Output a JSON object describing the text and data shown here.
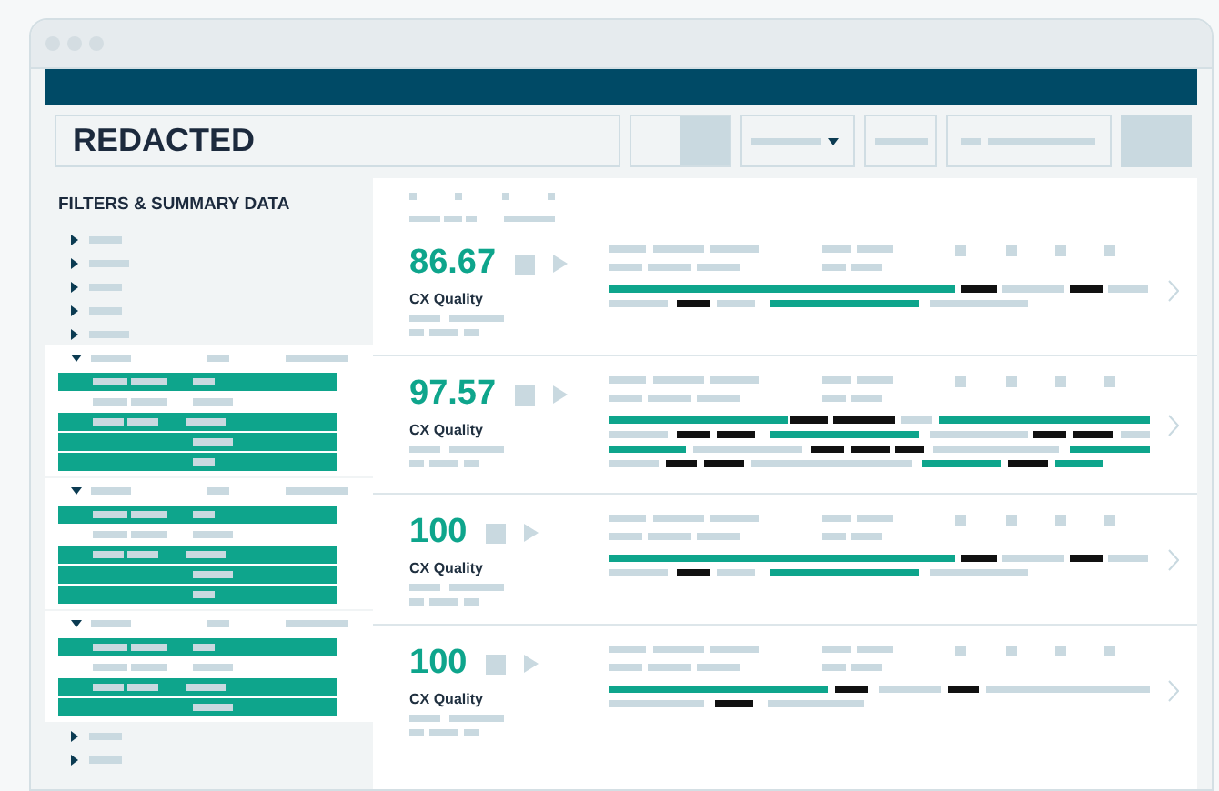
{
  "header": {
    "title": "REDACTED"
  },
  "sidebar": {
    "title": "FILTERS & SUMMARY DATA",
    "groups": [
      {
        "expanded": false
      },
      {
        "expanded": false
      },
      {
        "expanded": false
      },
      {
        "expanded": false
      },
      {
        "expanded": false
      },
      {
        "expanded": true,
        "rows": [
          {
            "selected": true
          },
          {
            "selected": false
          },
          {
            "selected": true
          },
          {
            "selected": true
          },
          {
            "selected": true
          }
        ]
      },
      {
        "expanded": true,
        "rows": [
          {
            "selected": true
          },
          {
            "selected": false
          },
          {
            "selected": true
          },
          {
            "selected": true
          },
          {
            "selected": true
          }
        ]
      },
      {
        "expanded": true,
        "rows": [
          {
            "selected": true
          },
          {
            "selected": false
          },
          {
            "selected": true
          },
          {
            "selected": true
          }
        ]
      },
      {
        "expanded": false
      },
      {
        "expanded": false
      }
    ]
  },
  "cards": [
    {
      "score": "86.67",
      "label": "CX Quality"
    },
    {
      "score": "97.57",
      "label": "CX Quality"
    },
    {
      "score": "100",
      "label": "CX Quality"
    },
    {
      "score": "100",
      "label": "CX Quality"
    }
  ]
}
